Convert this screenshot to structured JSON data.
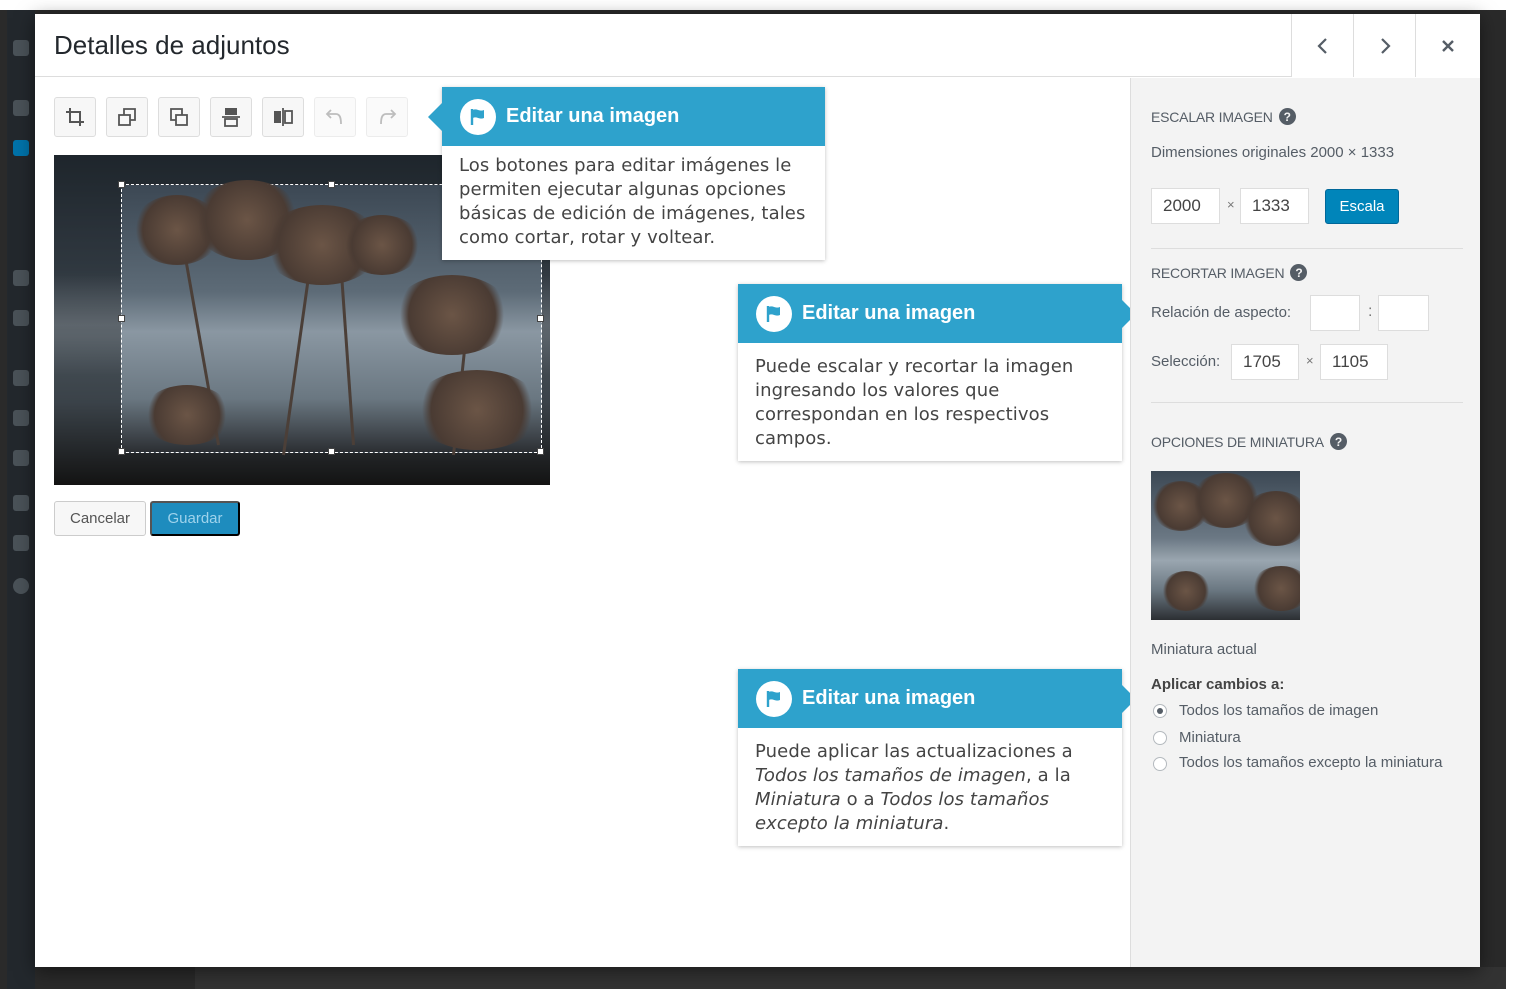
{
  "modal": {
    "title": "Detalles de adjuntos",
    "prev_icon": "chevron-left-icon",
    "next_icon": "chevron-right-icon",
    "close_icon": "close-icon"
  },
  "toolbar": {
    "buttons": [
      {
        "icon": "crop-icon",
        "enabled": true
      },
      {
        "icon": "rotate-left-icon",
        "enabled": true
      },
      {
        "icon": "rotate-right-icon",
        "enabled": true
      },
      {
        "icon": "flip-vertical-icon",
        "enabled": true
      },
      {
        "icon": "flip-horizontal-icon",
        "enabled": true
      },
      {
        "icon": "undo-icon",
        "enabled": false
      },
      {
        "icon": "redo-icon",
        "enabled": false
      }
    ]
  },
  "actions": {
    "cancel_label": "Cancelar",
    "save_label": "Guardar"
  },
  "sidebar": {
    "scale": {
      "title": "ESCALAR IMAGEN",
      "original_dims": "Dimensiones originales 2000 × 1333",
      "width": "2000",
      "height": "1333",
      "times": "×",
      "button": "Escala"
    },
    "crop": {
      "title": "RECORTAR IMAGEN",
      "aspect_label": "Relación de aspecto:",
      "aspect_w": "",
      "aspect_sep": ":",
      "aspect_h": "",
      "selection_label": "Selección:",
      "sel_w": "1705",
      "sel_h": "1105",
      "times": "×"
    },
    "thumb": {
      "title": "OPCIONES DE MINIATURA",
      "caption": "Miniatura actual",
      "apply_label": "Aplicar cambios a:",
      "options": [
        {
          "label": "Todos los tamaños de imagen",
          "checked": true
        },
        {
          "label": "Miniatura",
          "checked": false
        },
        {
          "label": "Todos los tamaños excepto la miniatura",
          "checked": false
        }
      ]
    }
  },
  "pointers": [
    {
      "title": "Editar una imagen",
      "body": "Los botones para editar imágenes le permiten ejecutar algunas opciones básicas de edición de imágenes, tales como cortar, rotar y voltear."
    },
    {
      "title": "Editar una imagen",
      "body": "Puede escalar y recortar la imagen ingresando los valores que correspondan en los respectivos campos."
    },
    {
      "title": "Editar una imagen",
      "body_parts": [
        "Puede aplicar las actualizaciones a ",
        "Todos los tamaños de imagen",
        ", a la ",
        "Miniatura",
        " o a ",
        "Todos los tamaños excepto la miniatura",
        "."
      ]
    }
  ],
  "colors": {
    "accent": "#2ea2cc",
    "primary_button": "#0085ba"
  }
}
